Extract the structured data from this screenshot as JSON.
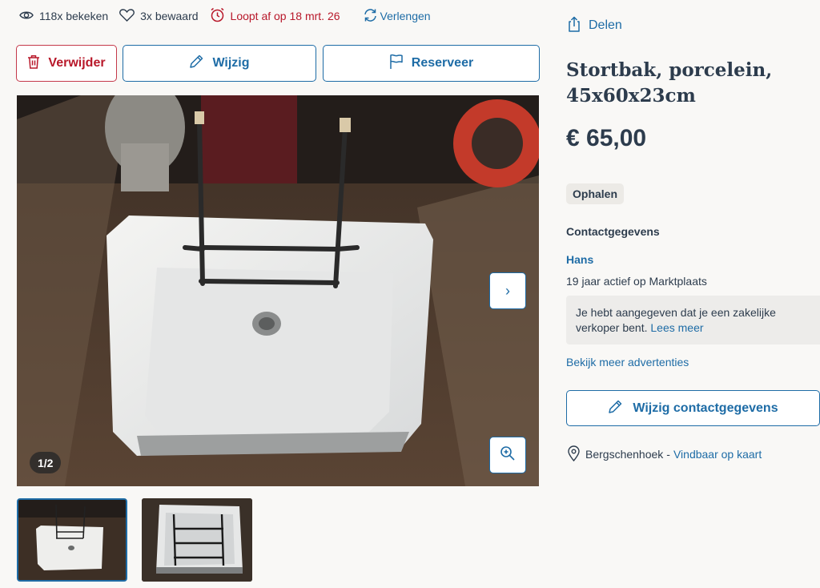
{
  "stats": {
    "views": "118x bekeken",
    "saved": "3x bewaard",
    "expires": "Loopt af op 18 mrt. 26",
    "renew": "Verlengen"
  },
  "actions": {
    "delete": "Verwijder",
    "edit": "Wijzig",
    "reserve": "Reserveer"
  },
  "gallery": {
    "counter": "1/2",
    "next": "›"
  },
  "listing": {
    "share": "Delen",
    "title": "Stortbak, porcelein, 45x60x23cm",
    "price": "€ 65,00",
    "delivery": "Ophalen"
  },
  "contact": {
    "heading": "Contactgegevens",
    "seller_name": "Hans",
    "active_since": "19 jaar actief op Marktplaats",
    "notice_text": "Je hebt aangegeven dat je een zakelijke verkoper bent.",
    "notice_link": "Lees meer",
    "more_ads": "Bekijk meer advertenties",
    "edit_button": "Wijzig contactgegevens",
    "city": "Bergschenhoek",
    "separator": "-",
    "map_link": "Vindbaar op kaart"
  },
  "colors": {
    "accent": "#1e6ca6",
    "danger": "#b8182a",
    "text": "#2d3c4d",
    "background": "#f9f8f6"
  }
}
